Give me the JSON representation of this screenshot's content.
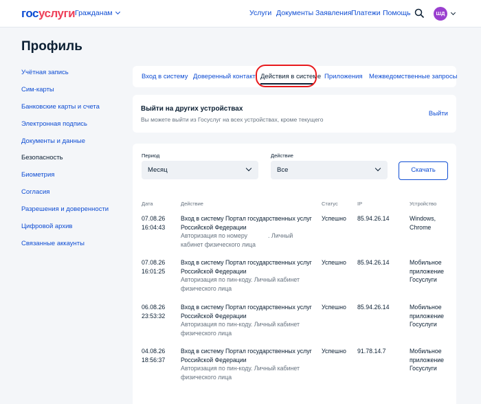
{
  "header": {
    "logo_part1": "гос",
    "logo_part2": "услуги",
    "audience": "Гражданам",
    "nav": [
      "Услуги",
      "Документы",
      "Заявления",
      "Платежи",
      "Помощь"
    ],
    "avatar_initials": "ШД"
  },
  "page": {
    "title": "Профиль"
  },
  "sidebar": {
    "items": [
      {
        "label": "Учётная запись"
      },
      {
        "label": "Сим-карты"
      },
      {
        "label": "Банковские карты и счета"
      },
      {
        "label": "Электронная подпись"
      },
      {
        "label": "Документы и данные"
      },
      {
        "label": "Безопасность",
        "active": true
      },
      {
        "label": "Биометрия"
      },
      {
        "label": "Согласия"
      },
      {
        "label": "Разрешения и доверенности"
      },
      {
        "label": "Цифровой архив"
      },
      {
        "label": "Связанные аккаунты"
      }
    ]
  },
  "tabs": {
    "items": [
      {
        "label": "Вход в систему"
      },
      {
        "label": "Доверенный контакт"
      },
      {
        "label": "Действия в системе",
        "active": true
      },
      {
        "label": "Приложения"
      },
      {
        "label": "Межведомственные запросы"
      }
    ]
  },
  "logout_card": {
    "title": "Выйти на других устройствах",
    "subtitle": "Вы можете выйти из Госуслуг на всех устройствах, кроме текущего",
    "link": "Выйти"
  },
  "filters": {
    "period_label": "Период",
    "period_value": "Месяц",
    "action_label": "Действие",
    "action_value": "Все",
    "download_button": "Скачать"
  },
  "table": {
    "headers": [
      "Дата",
      "Действие",
      "Статус",
      "IP",
      "Устройство"
    ],
    "rows": [
      {
        "date": "07.08.26",
        "time": "16:04:43",
        "action": "Вход в систему Портал государственных услуг Российской Федерации",
        "detail_a": "Авторизация по номеру",
        "detail_b": ". Личный кабинет физического лица",
        "status": "Успешно",
        "ip": "85.94.26.14",
        "device": "Windows, Chrome"
      },
      {
        "date": "07.08.26",
        "time": "16:01:25",
        "action": "Вход в систему Портал государственных услуг Российской Федерации",
        "detail_a": "Авторизация по пин-коду. Личный кабинет физического лица",
        "detail_b": "",
        "status": "Успешно",
        "ip": "85.94.26.14",
        "device": "Мобильное приложение Госуслуги"
      },
      {
        "date": "06.08.26",
        "time": "23:53:32",
        "action": "Вход в систему Портал государственных услуг Российской Федерации",
        "detail_a": "Авторизация по пин-коду. Личный кабинет физического лица",
        "detail_b": "",
        "status": "Успешно",
        "ip": "85.94.26.14",
        "device": "Мобильное приложение Госуслуги"
      },
      {
        "date": "04.08.26",
        "time": "18:56:37",
        "action": "Вход в систему Портал государственных услуг Российской Федерации",
        "detail_a": "Авторизация по пин-коду. Личный кабинет физического лица",
        "detail_b": "",
        "status": "Успешно",
        "ip": "91.78.14.7",
        "device": "Мобильное приложение Госуслуги"
      }
    ]
  },
  "colors": {
    "brand_blue": "#0d4cd3",
    "brand_red": "#ee3f58",
    "avatar": "#9a3fcf",
    "highlight": "#e8191c"
  }
}
